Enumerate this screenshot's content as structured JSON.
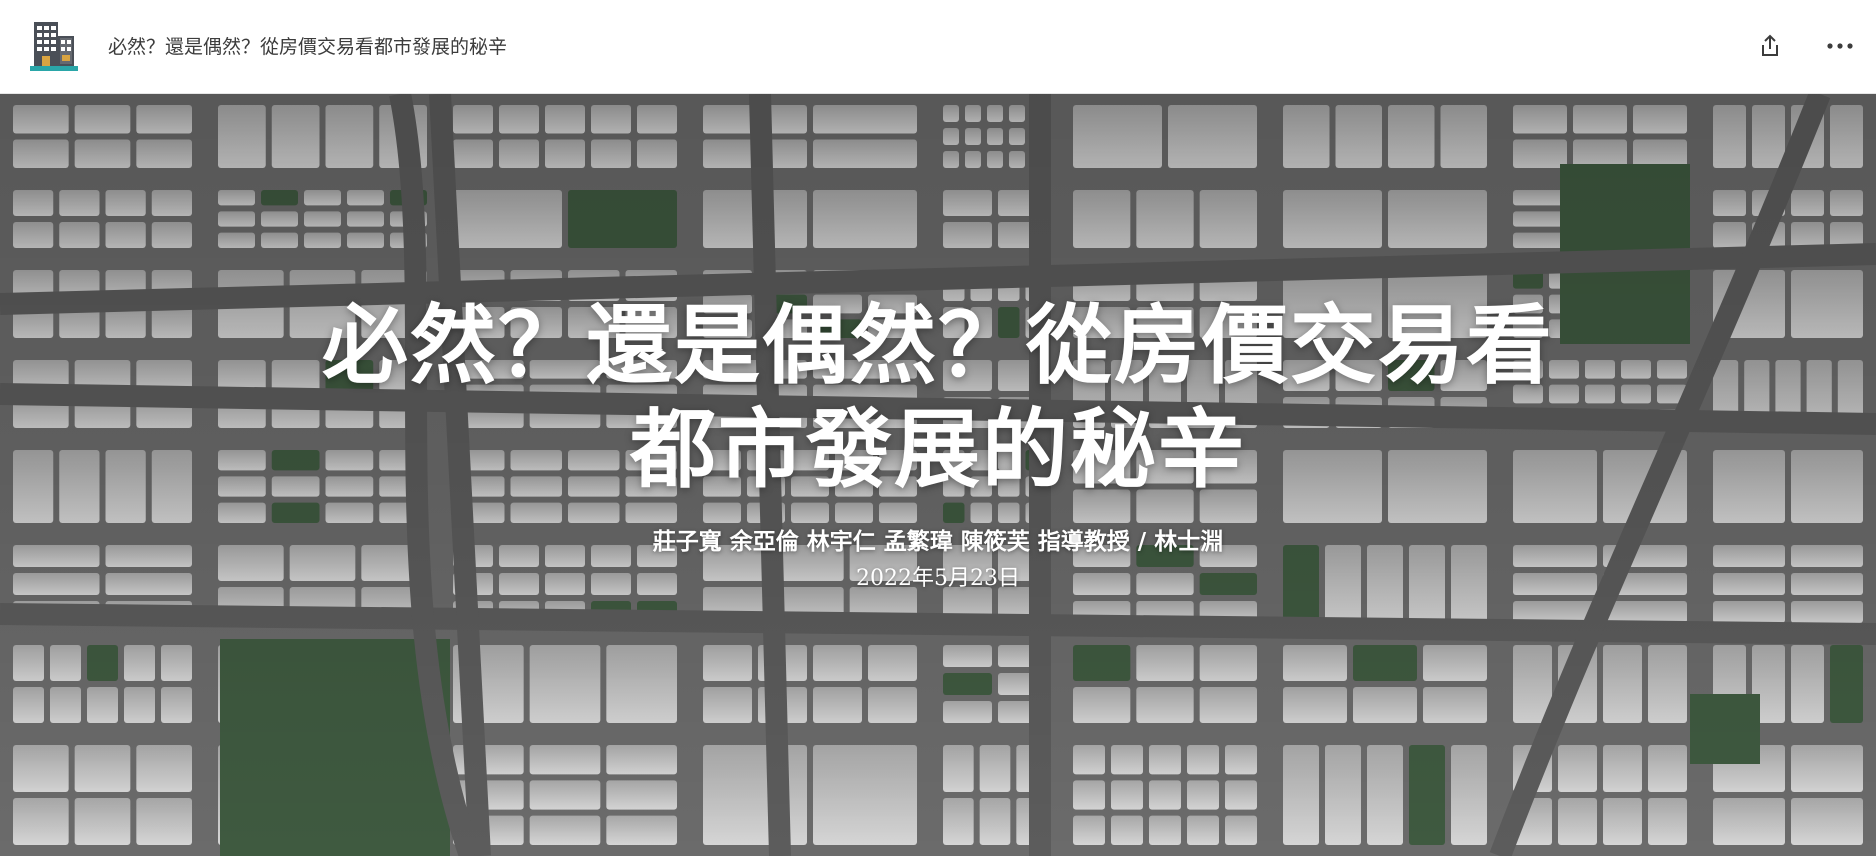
{
  "header": {
    "title": "必然？還是偶然？從房價交易看都市發展的秘辛",
    "logo_icon": "building-icon",
    "share_icon": "share-icon",
    "more_icon": "more-options-icon"
  },
  "hero": {
    "title_line1": "必然？還是偶然？從房價交易看",
    "title_line2": "都市發展的秘辛",
    "authors": "莊子寬 余亞倫 林宇仁 孟繁瑋 陳筱芙 指導教授 / 林士淵",
    "date": "2022年5月23日",
    "background": "city-map-illustration"
  },
  "colors": {
    "map_road": "#6e6e6e",
    "map_block": "#c4c4c4",
    "map_park": "#3f5a40",
    "text_primary": "#ffffff"
  }
}
